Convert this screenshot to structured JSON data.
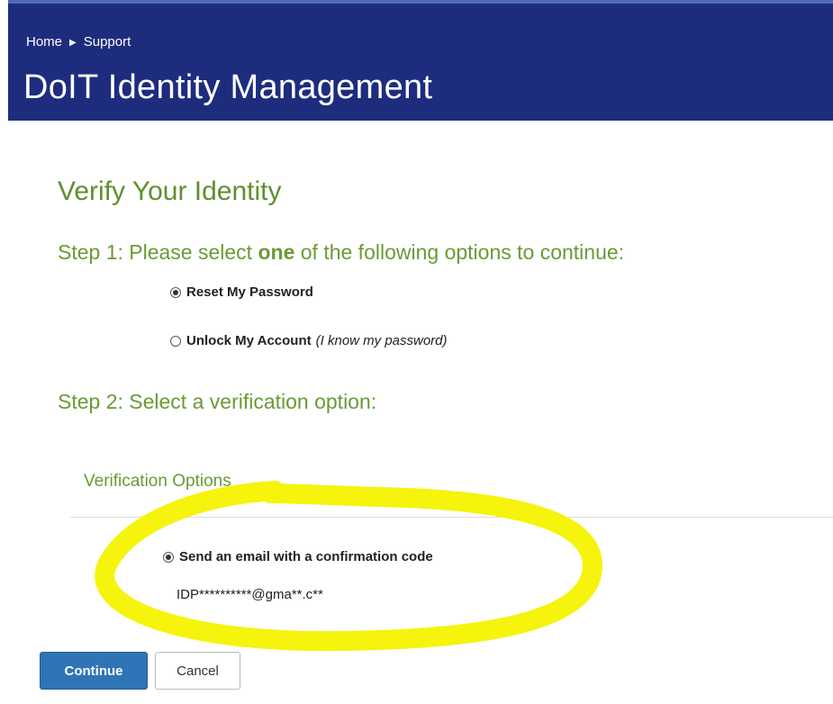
{
  "header": {
    "breadcrumb": [
      "Home",
      "Support"
    ],
    "title": "DoIT Identity Management",
    "background_color": "#1e2c7e"
  },
  "verify": {
    "title": "Verify Your Identity"
  },
  "step1": {
    "prefix": "Step 1: Please select ",
    "emphasis": "one",
    "suffix": " of the following options to continue:",
    "options": [
      {
        "label": "Reset My Password",
        "note": "",
        "checked": true
      },
      {
        "label": "Unlock My Account",
        "note": "(I know my password)",
        "checked": false
      }
    ]
  },
  "step2": {
    "title": "Step 2: Select a verification option:",
    "section_label": "Verification Options",
    "option_label": "Send an email with a confirmation code",
    "option_checked": true,
    "masked_email": "IDP**********@gma**.c**"
  },
  "buttons": {
    "continue_label": "Continue",
    "cancel_label": "Cancel"
  },
  "colors": {
    "accent_green": "#6a9a35",
    "primary_button": "#2f74b5",
    "highlight_yellow": "#f5f200"
  }
}
